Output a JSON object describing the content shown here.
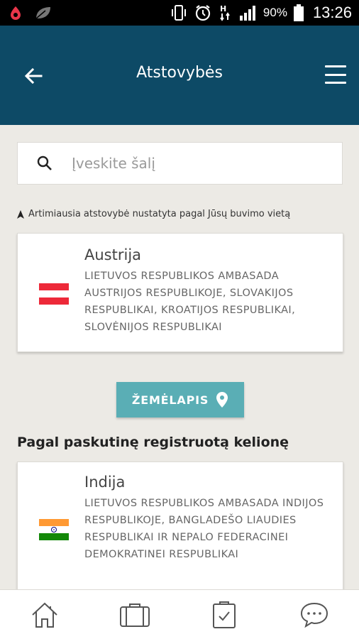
{
  "status_bar": {
    "battery_pct": "90%",
    "time": "13:26"
  },
  "header": {
    "title": "Atstovybės"
  },
  "search": {
    "placeholder": "Įveskite šalį",
    "value": ""
  },
  "note": "Artimiausia atstovybė nustatyta pagal Jūsų buvimo vietą",
  "nearest": {
    "country": "Austrija",
    "description": "LIETUVOS RESPUBLIKOS AMBASADA AUSTRIJOS RESPUBLIKOJE, SLOVAKIJOS RESPUBLIKAI, KROATIJOS RESPUBLIKAI, SLOVĖNIJOS RESPUBLIKAI",
    "flag": "austria-flag"
  },
  "map_button": {
    "label": "ŽEMĖLAPIS",
    "icon": "map-pin-icon"
  },
  "section": {
    "title": "Pagal paskutinę registruotą kelionę"
  },
  "last_trip": {
    "country": "Indija",
    "description": "LIETUVOS RESPUBLIKOS AMBASADA INDIJOS RESPUBLIKOJE, BANGLADEŠO LIAUDIES RESPUBLIKAI IR NEPALO FEDERACINEI DEMOKRATINEI RESPUBLIKAI",
    "flag": "india-flag"
  },
  "bottom_nav": [
    "home-icon",
    "suitcase-icon",
    "clipboard-check-icon",
    "chat-icon"
  ],
  "colors": {
    "appbar": "#0d4a66",
    "accent_button": "#5aaeb5",
    "background": "#eceae5"
  }
}
